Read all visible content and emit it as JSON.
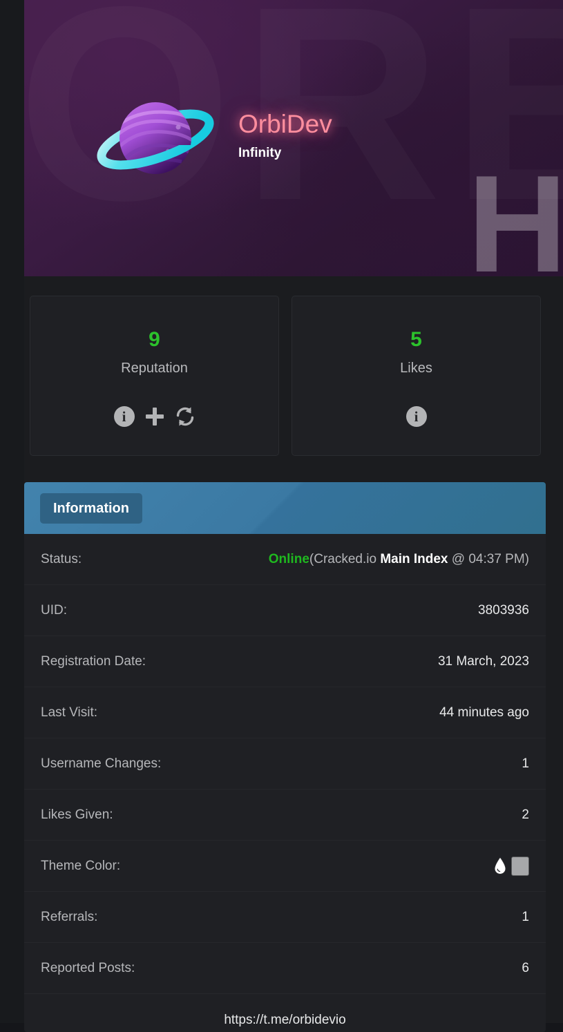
{
  "banner": {
    "username": "OrbiDev",
    "usertitle": "Infinity",
    "username_color": "#ff8e9e",
    "watermark_text": "ORBI",
    "corner_letter": "H",
    "avatar_icon": "planet-saturn-icon"
  },
  "stats": [
    {
      "value": "9",
      "label": "Reputation",
      "value_color": "#2cc22c",
      "icons": [
        "info-icon",
        "plus-icon",
        "sync-icon"
      ]
    },
    {
      "value": "5",
      "label": "Likes",
      "value_color": "#2cc22c",
      "icons": [
        "info-icon"
      ]
    }
  ],
  "info_panel": {
    "tab_label": "Information",
    "header_color": "#31708f",
    "rows": [
      {
        "key": "Status:",
        "status_online": "Online",
        "status_paren_open": "(Cracked.io ",
        "status_location": "Main Index",
        "status_paren_close": " @ 04:37 PM)",
        "type": "status"
      },
      {
        "key": "UID:",
        "value": "3803936",
        "type": "text"
      },
      {
        "key": "Registration Date:",
        "value": "31 March, 2023",
        "type": "text"
      },
      {
        "key": "Last Visit:",
        "value": "44 minutes ago",
        "type": "text"
      },
      {
        "key": "Username Changes:",
        "value": "1",
        "type": "text"
      },
      {
        "key": "Likes Given:",
        "value": "2",
        "type": "text"
      },
      {
        "key": "Theme Color:",
        "value": "",
        "type": "theme",
        "drop_color": "#ffffff",
        "chip_color": "#a7a8aa"
      },
      {
        "key": "Referrals:",
        "value": "1",
        "type": "text"
      },
      {
        "key": "Reported Posts:",
        "value": "6",
        "type": "text"
      }
    ],
    "footer_url": "https://t.me/orbidevio"
  }
}
